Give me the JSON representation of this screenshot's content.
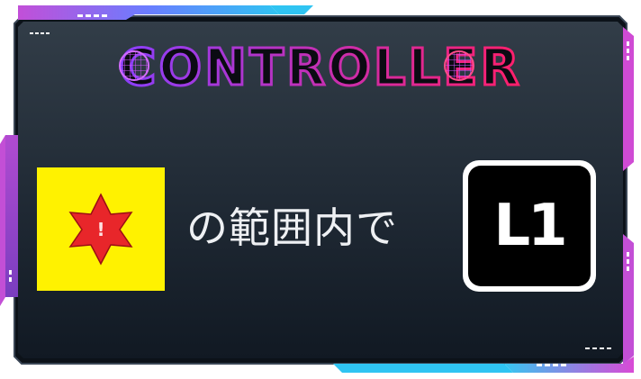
{
  "title": {
    "text": "CONTROLLER",
    "gradient_start": "#8a3ffc",
    "gradient_end": "#ff1f6a"
  },
  "frame": {
    "accent_cyan": "#29b6f6",
    "accent_magenta": "#e040fb",
    "panel_top": "#2f3a45",
    "panel_bottom": "#141c26"
  },
  "warning_card": {
    "icon": "warning-star-icon",
    "background": "#fff200",
    "star_color": "#e8262a",
    "mark": "!"
  },
  "instruction": {
    "text": "の範囲内で"
  },
  "button_key": {
    "label": "L1",
    "icon": "l1-button-icon"
  }
}
